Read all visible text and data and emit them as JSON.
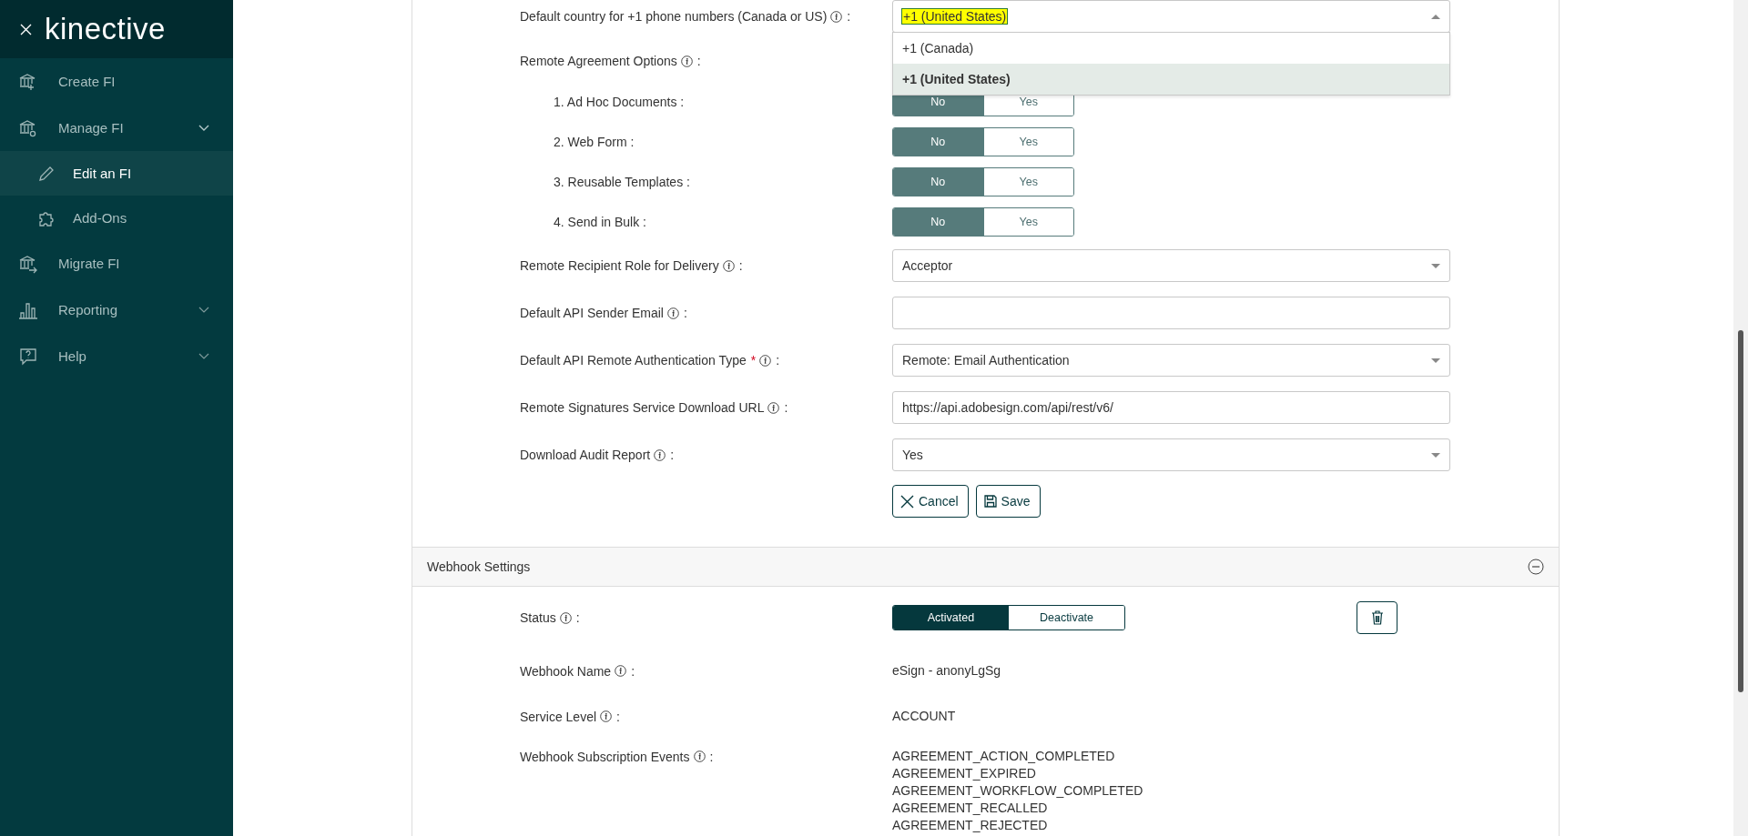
{
  "sidebar": {
    "logo": "kinective",
    "items": [
      {
        "label": "Create FI",
        "selected": false
      },
      {
        "label": "Manage FI",
        "selected": false,
        "expanded": true,
        "children": [
          {
            "label": "Edit an FI",
            "selected": true
          },
          {
            "label": "Add-Ons",
            "selected": false
          }
        ]
      },
      {
        "label": "Migrate FI",
        "selected": false
      },
      {
        "label": "Reporting",
        "selected": false,
        "expanded": false
      },
      {
        "label": "Help",
        "selected": false,
        "expanded": false
      }
    ]
  },
  "settings": {
    "rows": [
      {
        "kind": "select",
        "label": "Default country for +1 phone numbers (Canada or US)",
        "info": true,
        "suffix": ":",
        "value": "+1 (United States)",
        "highlighted": true,
        "open": true,
        "options": [
          {
            "label": "+1 (Canada)",
            "selected": false
          },
          {
            "label": "+1 (United States)",
            "selected": true
          }
        ]
      },
      {
        "kind": "heading",
        "label": "Remote Agreement Options",
        "info": true,
        "suffix": ":",
        "children": [
          {
            "kind": "toggle",
            "label": "1. Ad Hoc Documents :",
            "options": [
              {
                "label": "No",
                "selected": true
              },
              {
                "label": "Yes",
                "selected": false
              }
            ]
          },
          {
            "kind": "toggle",
            "label": "2. Web Form :",
            "options": [
              {
                "label": "No",
                "selected": true
              },
              {
                "label": "Yes",
                "selected": false
              }
            ]
          },
          {
            "kind": "toggle",
            "label": "3. Reusable Templates :",
            "options": [
              {
                "label": "No",
                "selected": true
              },
              {
                "label": "Yes",
                "selected": false
              }
            ]
          },
          {
            "kind": "toggle",
            "label": "4. Send in Bulk :",
            "options": [
              {
                "label": "No",
                "selected": true
              },
              {
                "label": "Yes",
                "selected": false
              }
            ]
          }
        ]
      },
      {
        "kind": "select",
        "label": "Remote Recipient Role for Delivery",
        "info": true,
        "suffix": ":",
        "value": "Acceptor",
        "highlighted": false,
        "open": false
      },
      {
        "kind": "text",
        "label": "Default API Sender Email",
        "info": true,
        "suffix": ":"
      },
      {
        "kind": "select",
        "label": "Default API Remote Authentication Type",
        "required_mark": "*",
        "info": true,
        "suffix": ":",
        "value": "Remote: Email Authentication",
        "highlighted": false,
        "open": false
      },
      {
        "kind": "text",
        "label": "Remote Signatures Service Download URL",
        "info": true,
        "suffix": ":",
        "value": "https://api.adobesign.com/api/rest/v6/"
      },
      {
        "kind": "select",
        "label": "Download Audit Report",
        "info": true,
        "suffix": ":",
        "value": "Yes",
        "highlighted": false,
        "open": false
      }
    ],
    "buttons": [
      {
        "label": "Cancel"
      },
      {
        "label": "Save"
      }
    ]
  },
  "webhook": {
    "title": "Webhook Settings",
    "expanded": true,
    "status": {
      "label": "Status",
      "info": true,
      "suffix": ":",
      "options": [
        {
          "label": "Activated",
          "selected": true
        },
        {
          "label": "Deactivate",
          "selected": false
        }
      ]
    },
    "fields": [
      {
        "label": "Webhook Name",
        "info": true,
        "suffix": ":",
        "values": [
          "eSign - anonyLgSg"
        ]
      },
      {
        "label": "Service Level",
        "info": true,
        "suffix": ":",
        "values": [
          "ACCOUNT"
        ]
      },
      {
        "label": "Webhook Subscription Events",
        "info": true,
        "suffix": ":",
        "values": [
          "AGREEMENT_ACTION_COMPLETED",
          "AGREEMENT_EXPIRED",
          "AGREEMENT_WORKFLOW_COMPLETED",
          "AGREEMENT_RECALLED",
          "AGREEMENT_REJECTED"
        ]
      }
    ]
  }
}
